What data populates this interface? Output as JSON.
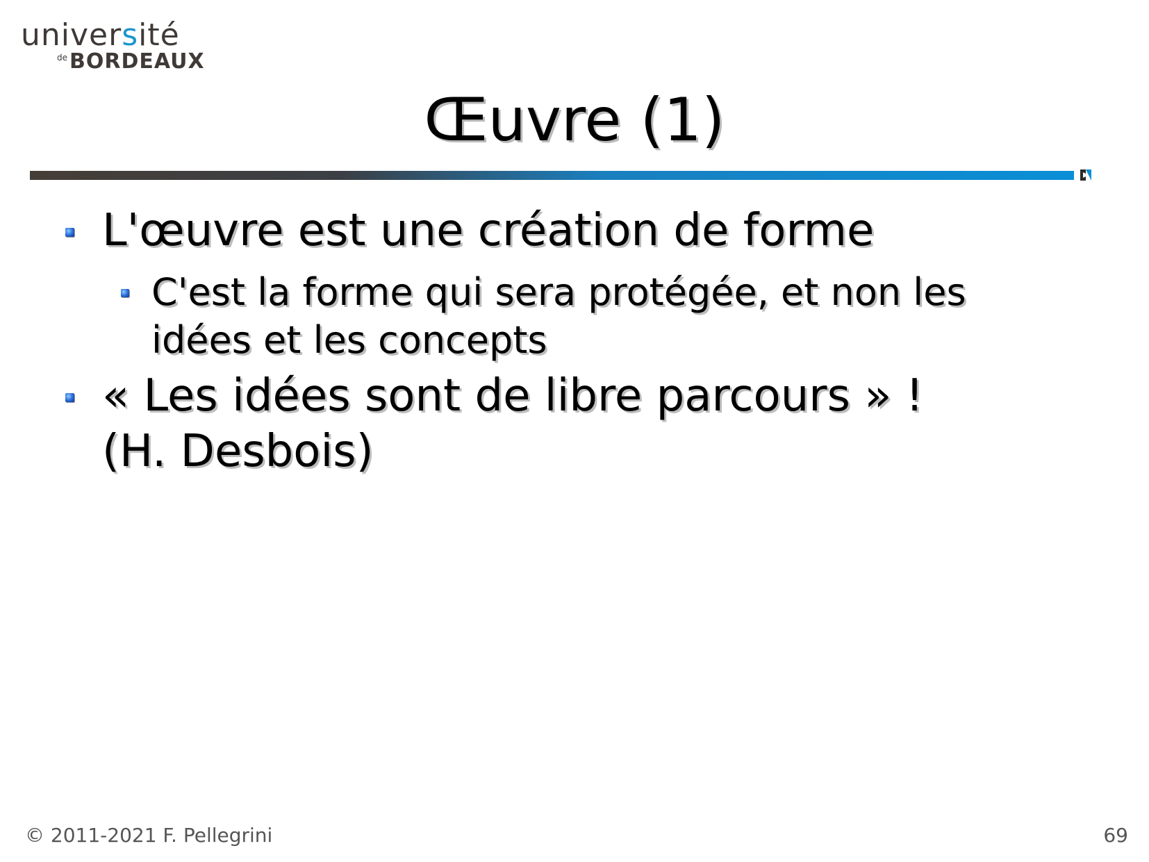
{
  "logo": {
    "line1_part1": "univer",
    "line1_accent": "s",
    "line1_part2": "ité",
    "de": "de",
    "bordeaux": "BORDEAUX"
  },
  "slide": {
    "title": "Œuvre (1)",
    "bullets": [
      {
        "text": "L'œuvre est une création de forme",
        "sub": [
          {
            "lines": [
              "C'est la forme qui sera protégée, et non les",
              "idées et les concepts"
            ]
          }
        ]
      },
      {
        "lines": [
          "« Les idées sont de libre parcours » !",
          "(H. Desbois)"
        ]
      }
    ]
  },
  "footer": {
    "copyright": "© 2011-2021 F. Pellegrini",
    "page_number": "69"
  },
  "colors": {
    "accent_blue": "#0a8fd6",
    "dark_brown": "#453d37",
    "bullet_blue": "#2a6fd8"
  }
}
